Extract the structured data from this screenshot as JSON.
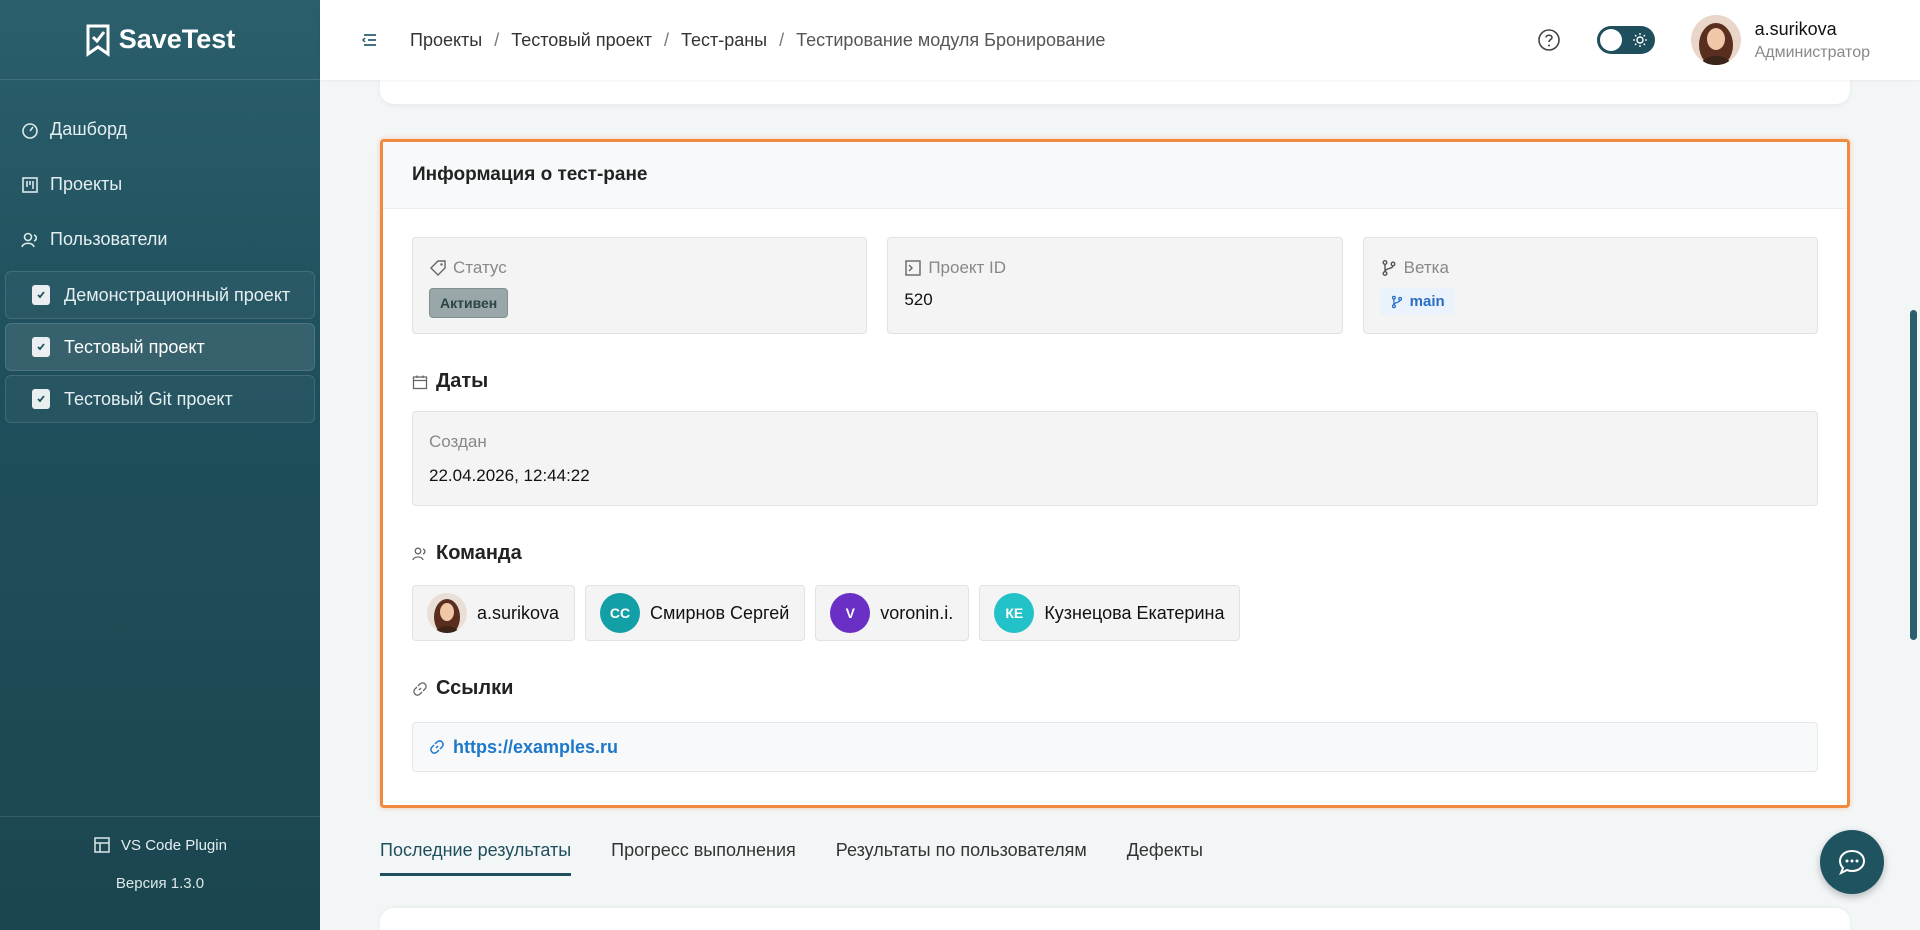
{
  "app": {
    "name": "SaveTest"
  },
  "sidebar": {
    "nav": [
      {
        "label": "Дашборд",
        "icon": "dashboard-icon"
      },
      {
        "label": "Проекты",
        "icon": "projects-icon"
      },
      {
        "label": "Пользователи",
        "icon": "users-icon"
      }
    ],
    "projects": [
      {
        "label": "Демонстрационный проект"
      },
      {
        "label": "Тестовый проект",
        "active": true
      },
      {
        "label": "Тестовый Git проект"
      }
    ],
    "vs_plugin": "VS Code Plugin",
    "version": "Версия 1.3.0"
  },
  "header": {
    "breadcrumb": [
      "Проекты",
      "Тестовый проект",
      "Тест-раны",
      "Тестирование модуля Бронирование"
    ],
    "user_name": "a.surikova",
    "user_role": "Администратор"
  },
  "info": {
    "title": "Информация о тест-ране",
    "status_label": "Статус",
    "status_value": "Активен",
    "project_id_label": "Проект ID",
    "project_id_value": "520",
    "branch_label": "Ветка",
    "branch_value": "main",
    "dates_title": "Даты",
    "created_label": "Создан",
    "created_value": "22.04.2026, 12:44:22",
    "team_title": "Команда",
    "team": [
      {
        "name": "a.surikova",
        "initials": "",
        "color": "#c9a48a"
      },
      {
        "name": "Смирнов Сергей",
        "initials": "СС",
        "color": "#12a0a6"
      },
      {
        "name": "voronin.i.",
        "initials": "V",
        "color": "#6a2fc4"
      },
      {
        "name": "Кузнецова Екатерина",
        "initials": "КЕ",
        "color": "#22c2c8"
      }
    ],
    "links_title": "Ссылки",
    "link": "https://examples.ru"
  },
  "tabs": [
    "Последние результаты",
    "Прогресс выполнения",
    "Результаты по пользователям",
    "Дефекты"
  ],
  "colors": {
    "accent": "#1f4f5c",
    "highlight": "#f08a3e",
    "link": "#1e78c8"
  }
}
